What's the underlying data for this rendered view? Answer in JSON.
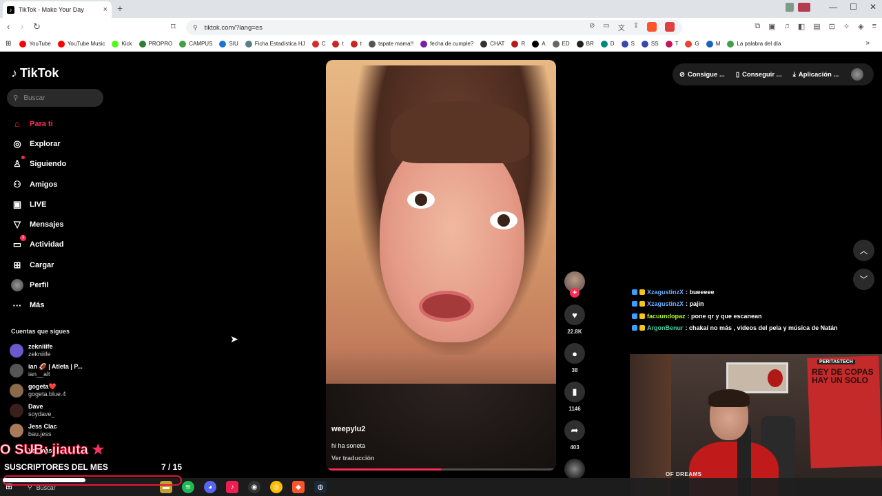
{
  "browser": {
    "tab_title": "TikTok - Make Your Day",
    "tab_close": "×",
    "new_tab": "+",
    "url": "tiktok.com/?lang=es",
    "window_controls": [
      "—",
      "☐",
      "✕"
    ],
    "bookmarks": [
      {
        "label": "YouTube",
        "color": "#ff0000"
      },
      {
        "label": "YouTube Music",
        "color": "#ff0000"
      },
      {
        "label": "Kick",
        "color": "#53fc18"
      },
      {
        "label": "PROPRO",
        "color": "#2e7d32"
      },
      {
        "label": "CAMPUS",
        "color": "#43a047"
      },
      {
        "label": "SIU",
        "color": "#1976d2"
      },
      {
        "label": "Ficha Estadística HJ",
        "color": "#607d8b"
      },
      {
        "label": "C",
        "color": "#d32f2f"
      },
      {
        "label": "t",
        "color": "#c62828"
      },
      {
        "label": "t",
        "color": "#c62828"
      },
      {
        "label": "tapate mama!!",
        "color": "#555555"
      },
      {
        "label": "fecha de cumple?",
        "color": "#7b1fa2"
      },
      {
        "label": "CHAT",
        "color": "#333333"
      },
      {
        "label": "R",
        "color": "#b71c1c"
      },
      {
        "label": "A",
        "color": "#000000"
      },
      {
        "label": "ED",
        "color": "#666666"
      },
      {
        "label": "BR",
        "color": "#222222"
      },
      {
        "label": "D",
        "color": "#00897b"
      },
      {
        "label": "S",
        "color": "#3949ab"
      },
      {
        "label": "SS",
        "color": "#3949ab"
      },
      {
        "label": "T",
        "color": "#c2185b"
      },
      {
        "label": "G",
        "color": "#ea4335"
      },
      {
        "label": "M",
        "color": "#1565c0"
      },
      {
        "label": "La palabra del día",
        "color": "#43a047"
      }
    ],
    "bookmarks_more": "»"
  },
  "sidebar": {
    "logo": "TikTok",
    "search_placeholder": "Buscar",
    "nav": [
      {
        "label": "Para ti",
        "icon": "home-icon",
        "glyph": "⌂"
      },
      {
        "label": "Explorar",
        "icon": "compass-icon",
        "glyph": "◎"
      },
      {
        "label": "Siguiendo",
        "icon": "following-icon",
        "glyph": "♙"
      },
      {
        "label": "Amigos",
        "icon": "friends-icon",
        "glyph": "⚇"
      },
      {
        "label": "LIVE",
        "icon": "live-icon",
        "glyph": "▣"
      },
      {
        "label": "Mensajes",
        "icon": "messages-icon",
        "glyph": "▽"
      },
      {
        "label": "Actividad",
        "icon": "activity-icon",
        "glyph": "▭",
        "badge": "1"
      },
      {
        "label": "Cargar",
        "icon": "upload-icon",
        "glyph": "⊞"
      },
      {
        "label": "Perfil",
        "icon": "profile-avatar",
        "glyph": ""
      },
      {
        "label": "Más",
        "icon": "more-icon",
        "glyph": "···"
      }
    ],
    "following_title": "Cuentas que sigues",
    "following": [
      {
        "name": "zekniiife",
        "handle": "zekniiife",
        "color": "#6a5acd"
      },
      {
        "name": "ian 🏈 | Atleta | P...",
        "handle": "ian__alt",
        "color": "#555555"
      },
      {
        "name": "gogeta❤️",
        "handle": "gogeta.blue.4",
        "color": "#8a6a4a"
      },
      {
        "name": "Dave",
        "handle": "soydave_",
        "color": "#3a1f1f"
      },
      {
        "name": "Jess Clac",
        "handle": "bau.jess",
        "color": "#a87a5a"
      },
      {
        "name": "Ver más",
        "handle": "",
        "color": "#000000"
      }
    ]
  },
  "video": {
    "username": "weepylu2",
    "description": "hi ha soneta",
    "translate": "Ver traducción",
    "progress": 0.5,
    "likes": "22.8K",
    "comments": "38",
    "saves": "1146",
    "shares": "403"
  },
  "top_bar": {
    "items": [
      {
        "label": "Consigue ...",
        "icon": "coin-icon",
        "glyph": "⊘"
      },
      {
        "label": "Conseguir ...",
        "icon": "phone-icon",
        "glyph": "▯"
      },
      {
        "label": "Aplicación ...",
        "icon": "download-icon",
        "glyph": "⤓"
      }
    ],
    "up_arrow": "︿",
    "down_arrow": "﹀"
  },
  "chat": [
    {
      "user": "XzagustinzX",
      "message": ": bueeeee",
      "color": "#6ab0ff"
    },
    {
      "user": "XzagustinzX",
      "message": ": pajin",
      "color": "#6ab0ff"
    },
    {
      "user": "facuundopaz",
      "message": ": pone qr y que escanean",
      "color": "#b8ff2a"
    },
    {
      "user": "ArgonBenur",
      "message": ": chakai no más , videos del pela y música de Natán",
      "color": "#4ad0a0"
    }
  ],
  "webcam": {
    "poster_top": "PERITASTECH",
    "poster_text": "REY DE COPAS HAY UN SOLO",
    "shirt_text": "OF DREAMS"
  },
  "stream_overlay": {
    "sub_text": "O SUB: jiauta",
    "sub_star": "★",
    "subs_label": "SUSCRIPTORES DEL MES",
    "subs_count": "7 / 15",
    "subs_progress": 0.47
  },
  "taskbar": {
    "search_label": "Buscar"
  },
  "colors": {
    "accent": "#fe2c55",
    "background": "#000000",
    "stream_red": "#e8153a"
  }
}
